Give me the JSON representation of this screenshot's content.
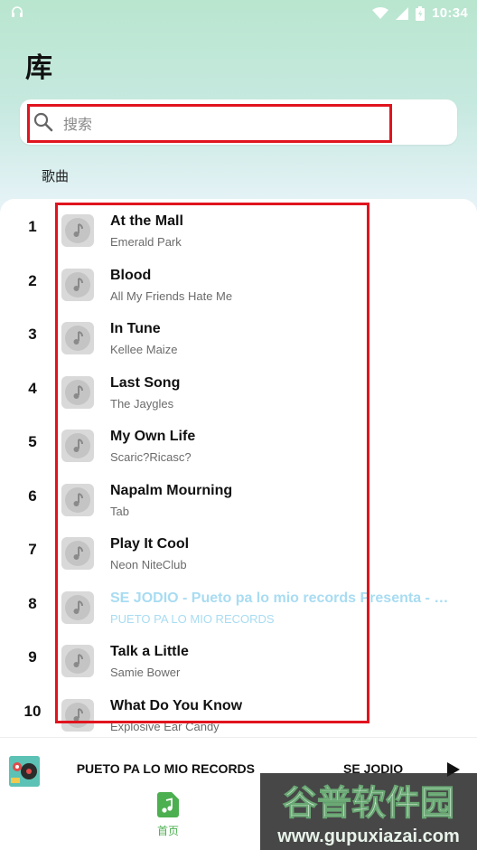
{
  "status_bar": {
    "time": "10:34"
  },
  "page": {
    "title": "库",
    "section_label": "歌曲"
  },
  "search": {
    "placeholder": "搜索",
    "value": ""
  },
  "songs": [
    {
      "index": "1",
      "title": "At the Mall",
      "artist": "Emerald Park"
    },
    {
      "index": "2",
      "title": "Blood",
      "artist": "All My Friends Hate Me"
    },
    {
      "index": "3",
      "title": "In Tune",
      "artist": "Kellee Maize"
    },
    {
      "index": "4",
      "title": "Last Song",
      "artist": "The Jaygles"
    },
    {
      "index": "5",
      "title": "My Own Life",
      "artist": "Scaric?Ricasc?"
    },
    {
      "index": "6",
      "title": "Napalm Mourning",
      "artist": "Tab"
    },
    {
      "index": "7",
      "title": "Play It Cool",
      "artist": "Neon NiteClub"
    },
    {
      "index": "8",
      "title": "SE JODIO - Pueto pa lo mio records Presenta - Chief Cherry Grap",
      "artist": "PUETO PA LO MIO RECORDS",
      "active": true
    },
    {
      "index": "9",
      "title": "Talk a Little",
      "artist": "Samie Bower"
    },
    {
      "index": "10",
      "title": "What Do You Know",
      "artist": "Explosive Ear Candy"
    }
  ],
  "player": {
    "artist": "PUETO PA LO MIO RECORDS",
    "title": "SE JODIO -"
  },
  "bottom_nav": {
    "home_label": "首页"
  },
  "watermark": {
    "text": "谷普软件园",
    "url": "www.gupuxiazai.com"
  },
  "colors": {
    "highlight_box": "#e0141e",
    "active_song": "#a8dcf2",
    "nav_active": "#4caf50"
  },
  "icons": {
    "search": "search-icon",
    "song_art": "music-note-icon",
    "play": "play-icon",
    "home": "home-music-icon"
  }
}
